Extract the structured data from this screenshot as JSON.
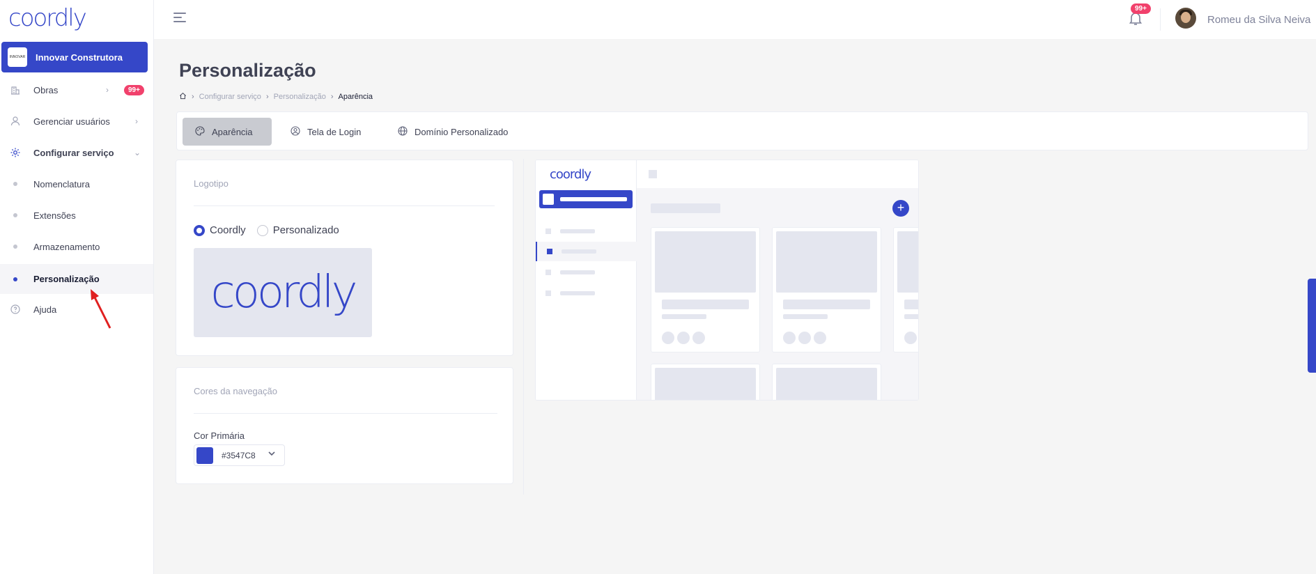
{
  "app": {
    "logo_text": "coordly",
    "accent": "#3547C8",
    "badge_color": "#F1416C"
  },
  "sidebar": {
    "org": {
      "name": "Innovar Construtora",
      "logo_text": "INNOVAR"
    },
    "items": [
      {
        "label": "Obras",
        "icon": "building-icon",
        "badge": "99+"
      },
      {
        "label": "Gerenciar usuários",
        "icon": "user-icon"
      },
      {
        "label": "Configurar serviço",
        "icon": "gear-icon"
      },
      {
        "label": "Nomenclatura"
      },
      {
        "label": "Extensões"
      },
      {
        "label": "Armazenamento"
      },
      {
        "label": "Personalização"
      },
      {
        "label": "Ajuda",
        "icon": "help-icon"
      }
    ]
  },
  "header": {
    "notification_count": "99+",
    "user_name": "Romeu da Silva Neiva"
  },
  "page": {
    "title": "Personalização",
    "breadcrumb": [
      "Configurar serviço",
      "Personalização",
      "Aparência"
    ]
  },
  "tabs": [
    {
      "label": "Aparência",
      "icon": "palette-icon",
      "active": true
    },
    {
      "label": "Tela de Login",
      "icon": "user-circle-icon"
    },
    {
      "label": "Domínio Personalizado",
      "icon": "globe-icon"
    }
  ],
  "logo_card": {
    "title": "Logotipo",
    "options": [
      "Coordly",
      "Personalizado"
    ],
    "selected": "Coordly",
    "preview_text": "coordly"
  },
  "colors_card": {
    "title": "Cores da navegação",
    "primary_label": "Cor Primária",
    "primary_value": "#3547C8"
  },
  "preview": {
    "logo_text": "coordly",
    "plus": "+"
  }
}
